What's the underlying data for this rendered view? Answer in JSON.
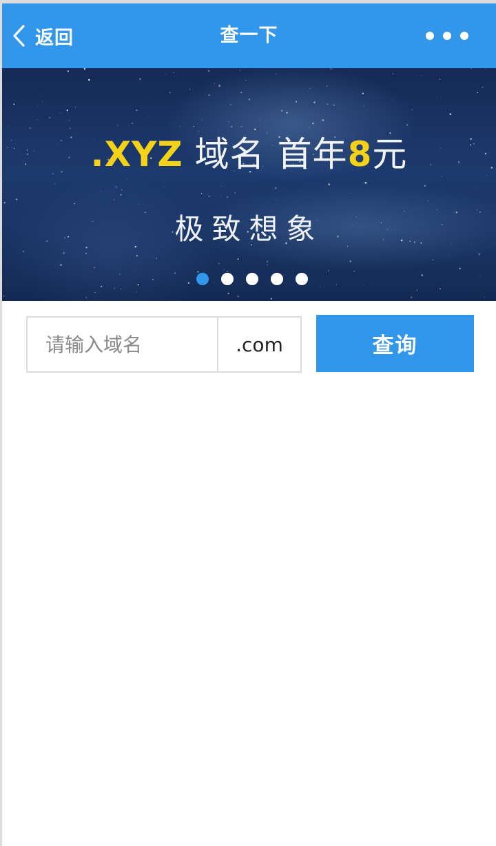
{
  "header": {
    "back_label": "返回",
    "title": "查一下"
  },
  "banner": {
    "headline_tld": ".XYZ",
    "headline_text1": "域名",
    "headline_text2": "首年",
    "headline_price": "8",
    "headline_unit": "元",
    "subline": "极致想象",
    "slide_count": 5,
    "active_slide": 1
  },
  "search": {
    "placeholder": "请输入域名",
    "value": "",
    "tld": ".com",
    "button_label": "查询"
  },
  "colors": {
    "primary": "#3296ea",
    "accent_yellow": "#f4d21a",
    "border": "#dcdcdc"
  }
}
